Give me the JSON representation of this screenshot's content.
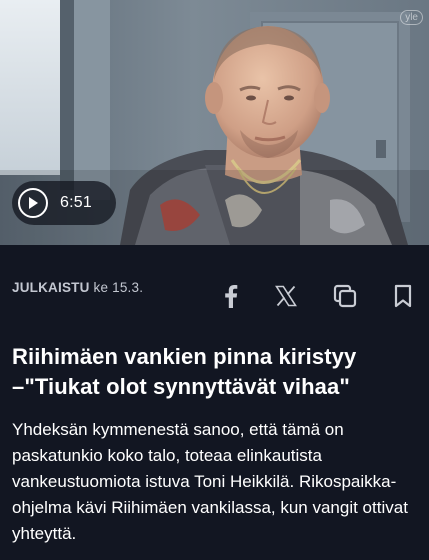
{
  "video": {
    "duration": "6:51",
    "play_icon": "play-icon",
    "channel_logo": "yle"
  },
  "meta": {
    "published_label": "JULKAISTU",
    "published_date": "ke 15.3."
  },
  "share": {
    "facebook_icon": "facebook-icon",
    "x_icon": "x-icon",
    "copy_icon": "copy-link-icon",
    "bookmark_icon": "bookmark-icon"
  },
  "article": {
    "headline": "Riihimäen vankien pinna kiristyy –\"Tiukat olot synnyttävät vihaa\"",
    "lead": "Yhdeksän kymmenestä sanoo, että tämä on paskatunkio koko talo, toteaa elinkautista vankeustuomiota istuva Toni Heikkilä. Rikospaikka-ohjelma kävi Riihimäen vankilassa, kun vangit ottivat yhteyttä."
  },
  "colors": {
    "background": "#121622",
    "text_primary": "#ffffff",
    "text_secondary": "#c3c7d1",
    "icon": "#c9ccd4"
  }
}
